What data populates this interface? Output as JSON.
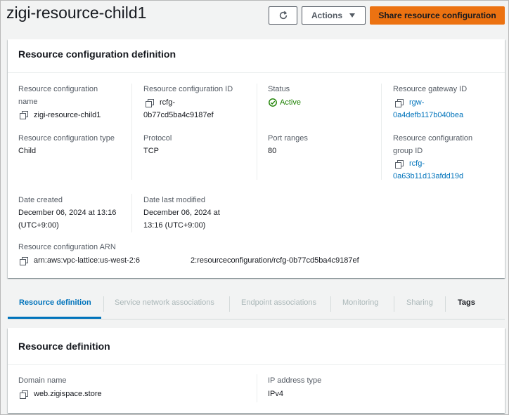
{
  "page": {
    "title": "zigi-resource-child1"
  },
  "header_buttons": {
    "actions_label": "Actions",
    "share_label": "Share resource configuration"
  },
  "definition_card": {
    "title": "Resource configuration definition",
    "fields": {
      "name_label": "Resource configuration name",
      "name_value": "zigi-resource-child1",
      "id_label": "Resource configuration ID",
      "id_value_line1": "rcfg-",
      "id_value_line2": "0b77cd5ba4c9187ef",
      "status_label": "Status",
      "status_value": "Active",
      "gateway_label": "Resource gateway ID",
      "gateway_value_line1": "rgw-",
      "gateway_value_line2": "0a4defb117b040bea",
      "type_label": "Resource configuration type",
      "type_value": "Child",
      "protocol_label": "Protocol",
      "protocol_value": "TCP",
      "port_label": "Port ranges",
      "port_value": "80",
      "group_label_line1": "Resource configuration",
      "group_label_line2": "group ID",
      "group_value_line1": "rcfg-",
      "group_value_line2": "0a63b11d13afdd19d",
      "created_label": "Date created",
      "created_value_line1": "December 06, 2024 at 13:16",
      "created_value_line2": "(UTC+9:00)",
      "modified_label": "Date last modified",
      "modified_value_line1": "December 06, 2024 at",
      "modified_value_line2": "13:16 (UTC+9:00)",
      "arn_label": "Resource configuration ARN",
      "arn_value_part1": "arn:aws:vpc-lattice:us-west-2:6",
      "arn_value_part2": "2:resourceconfiguration/rcfg-0b77cd5ba4c9187ef"
    }
  },
  "tabs": [
    {
      "label": "Resource definition"
    },
    {
      "label": "Service network associations"
    },
    {
      "label": "Endpoint associations"
    },
    {
      "label": "Monitoring"
    },
    {
      "label": "Sharing"
    },
    {
      "label": "Tags"
    }
  ],
  "resource_card": {
    "title": "Resource definition",
    "domain_label": "Domain name",
    "domain_value": "web.zigispace.store",
    "ip_label": "IP address type",
    "ip_value": "IPv4"
  },
  "colors": {
    "primary": "#ec7211",
    "link": "#0073bb",
    "success": "#1d8102"
  }
}
